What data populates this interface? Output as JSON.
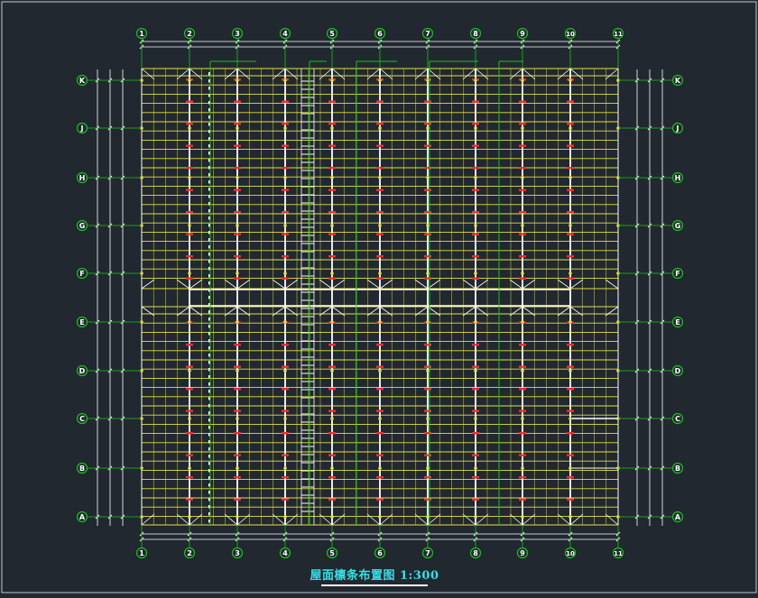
{
  "drawing": {
    "title": "屋面檩条布置图 1:300",
    "column_axes": [
      "1",
      "2",
      "3",
      "4",
      "5",
      "6",
      "7",
      "8",
      "9",
      "10",
      "11"
    ],
    "row_axes": [
      "K",
      "J",
      "H",
      "G",
      "F",
      "E",
      "D",
      "C",
      "B",
      "A"
    ]
  },
  "colors": {
    "background": "#212830",
    "frame": "#c8c8c8",
    "axis_bubble": "#18c218",
    "axis_line": "#18c218",
    "purlin": "#e4e23a",
    "rafter": "#ffffff",
    "marker": "#ff2a2a",
    "dimension": "#ffffff",
    "title": "#35e0e6"
  }
}
